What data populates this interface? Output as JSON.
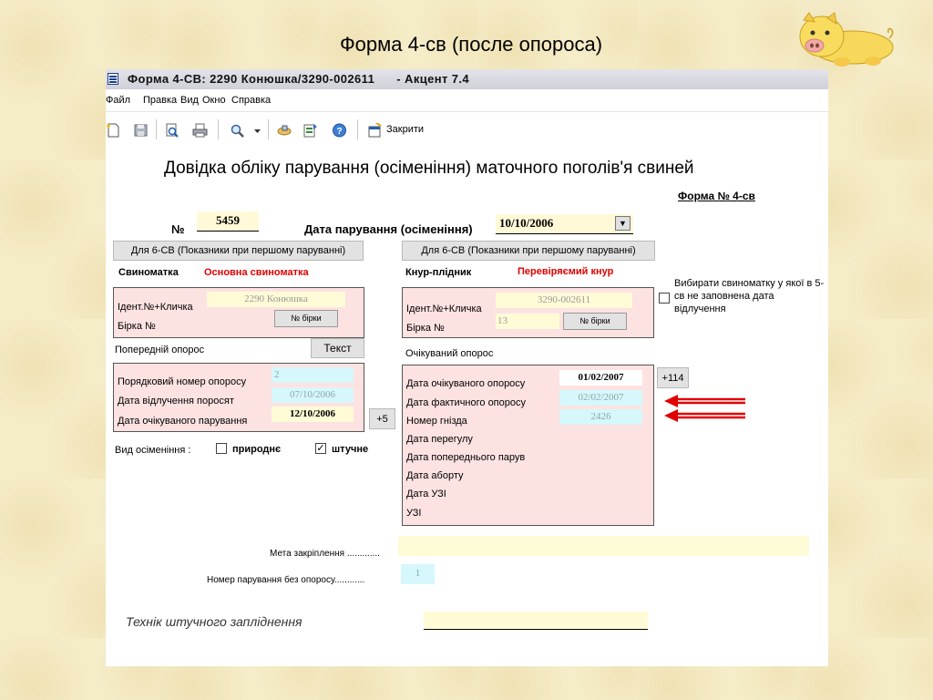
{
  "slide": {
    "title": "Форма 4-св (после опороса)"
  },
  "window": {
    "title": "Форма 4-СВ: 2290 Конюшка/3290-002611      - Акцент 7.4",
    "menu": [
      "Файл",
      "Правка",
      "Вид",
      "Окно",
      "Справка"
    ],
    "toolbar_close_label": "Закрити"
  },
  "form": {
    "heading": "Довідка обліку парування (осіменіння) маточного поголів'я свиней",
    "forma_label": "Форма № 4-св",
    "number_label": "№",
    "number_value": "5459",
    "date_label": "Дата парування (осіменіння)",
    "date_value": "10/10/2006",
    "btn_6sv_left": "Для 6-СВ (Показники при першому паруванні)",
    "btn_6sv_right": "Для 6-СВ (Показники при першому паруванні)",
    "sow": {
      "header": "Свиноматка",
      "type": "Основна свиноматка",
      "ident_label": "Ідент.№+Кличка",
      "ident_value": "2290 Конюшка",
      "tag_label": "Бірка №",
      "tag_value": "",
      "tag_button": "№ бірки"
    },
    "boar": {
      "header": "Кнур-плідник",
      "type": "Перевіряємий кнур",
      "ident_label": "Ідент.№+Кличка",
      "ident_value": "3290-002611",
      "tag_label": "Бірка №",
      "tag_value": "13",
      "tag_button": "№ бірки"
    },
    "choose_sow_note": "Вибирати свиноматку у якої в 5-св не заповнена дата відлучення",
    "prev_farrow": {
      "title": "Попередній опорос",
      "text_button": "Текст",
      "order_label": "Порядковий номер опоросу",
      "order_value": "2",
      "weaning_label": "Дата відлучення поросят",
      "weaning_value": "07/10/2006",
      "expected_mating_label": "Дата очікуваного парування",
      "expected_mating_value": "12/10/2006",
      "plus_button": "+5"
    },
    "insemination": {
      "label": "Вид осіменіння :",
      "natural_label": "природнє",
      "natural_checked": false,
      "artificial_label": "штучне",
      "artificial_checked": true
    },
    "expected_farrow": {
      "title": "Очікуваний опорос",
      "rows": [
        {
          "label": "Дата очікуваного опоросу",
          "value": "01/02/2007"
        },
        {
          "label": "Дата фактичного опоросу",
          "value": "02/02/2007"
        },
        {
          "label": "Номер гнізда",
          "value": "2426"
        },
        {
          "label": "Дата перегулу",
          "value": ""
        },
        {
          "label": "Дата попереднього парув",
          "value": ""
        },
        {
          "label": "Дата аборту",
          "value": ""
        },
        {
          "label": "Дата УЗІ",
          "value": ""
        },
        {
          "label": "УЗІ",
          "value": ""
        }
      ],
      "plus_button": "+114"
    },
    "goal_label": "Мета закріплення .............",
    "goal_value": "",
    "mating_no_farrow_label": "Номер парування без опоросу............",
    "mating_no_farrow_value": "1",
    "technician_label": "Технік штучного запліднення",
    "technician_value": ""
  },
  "colors": {
    "arrow": "#e00000",
    "panel": "#fde2e2",
    "cyan_field": "#d6f7fb",
    "yellow_field": "#fffbd6"
  }
}
